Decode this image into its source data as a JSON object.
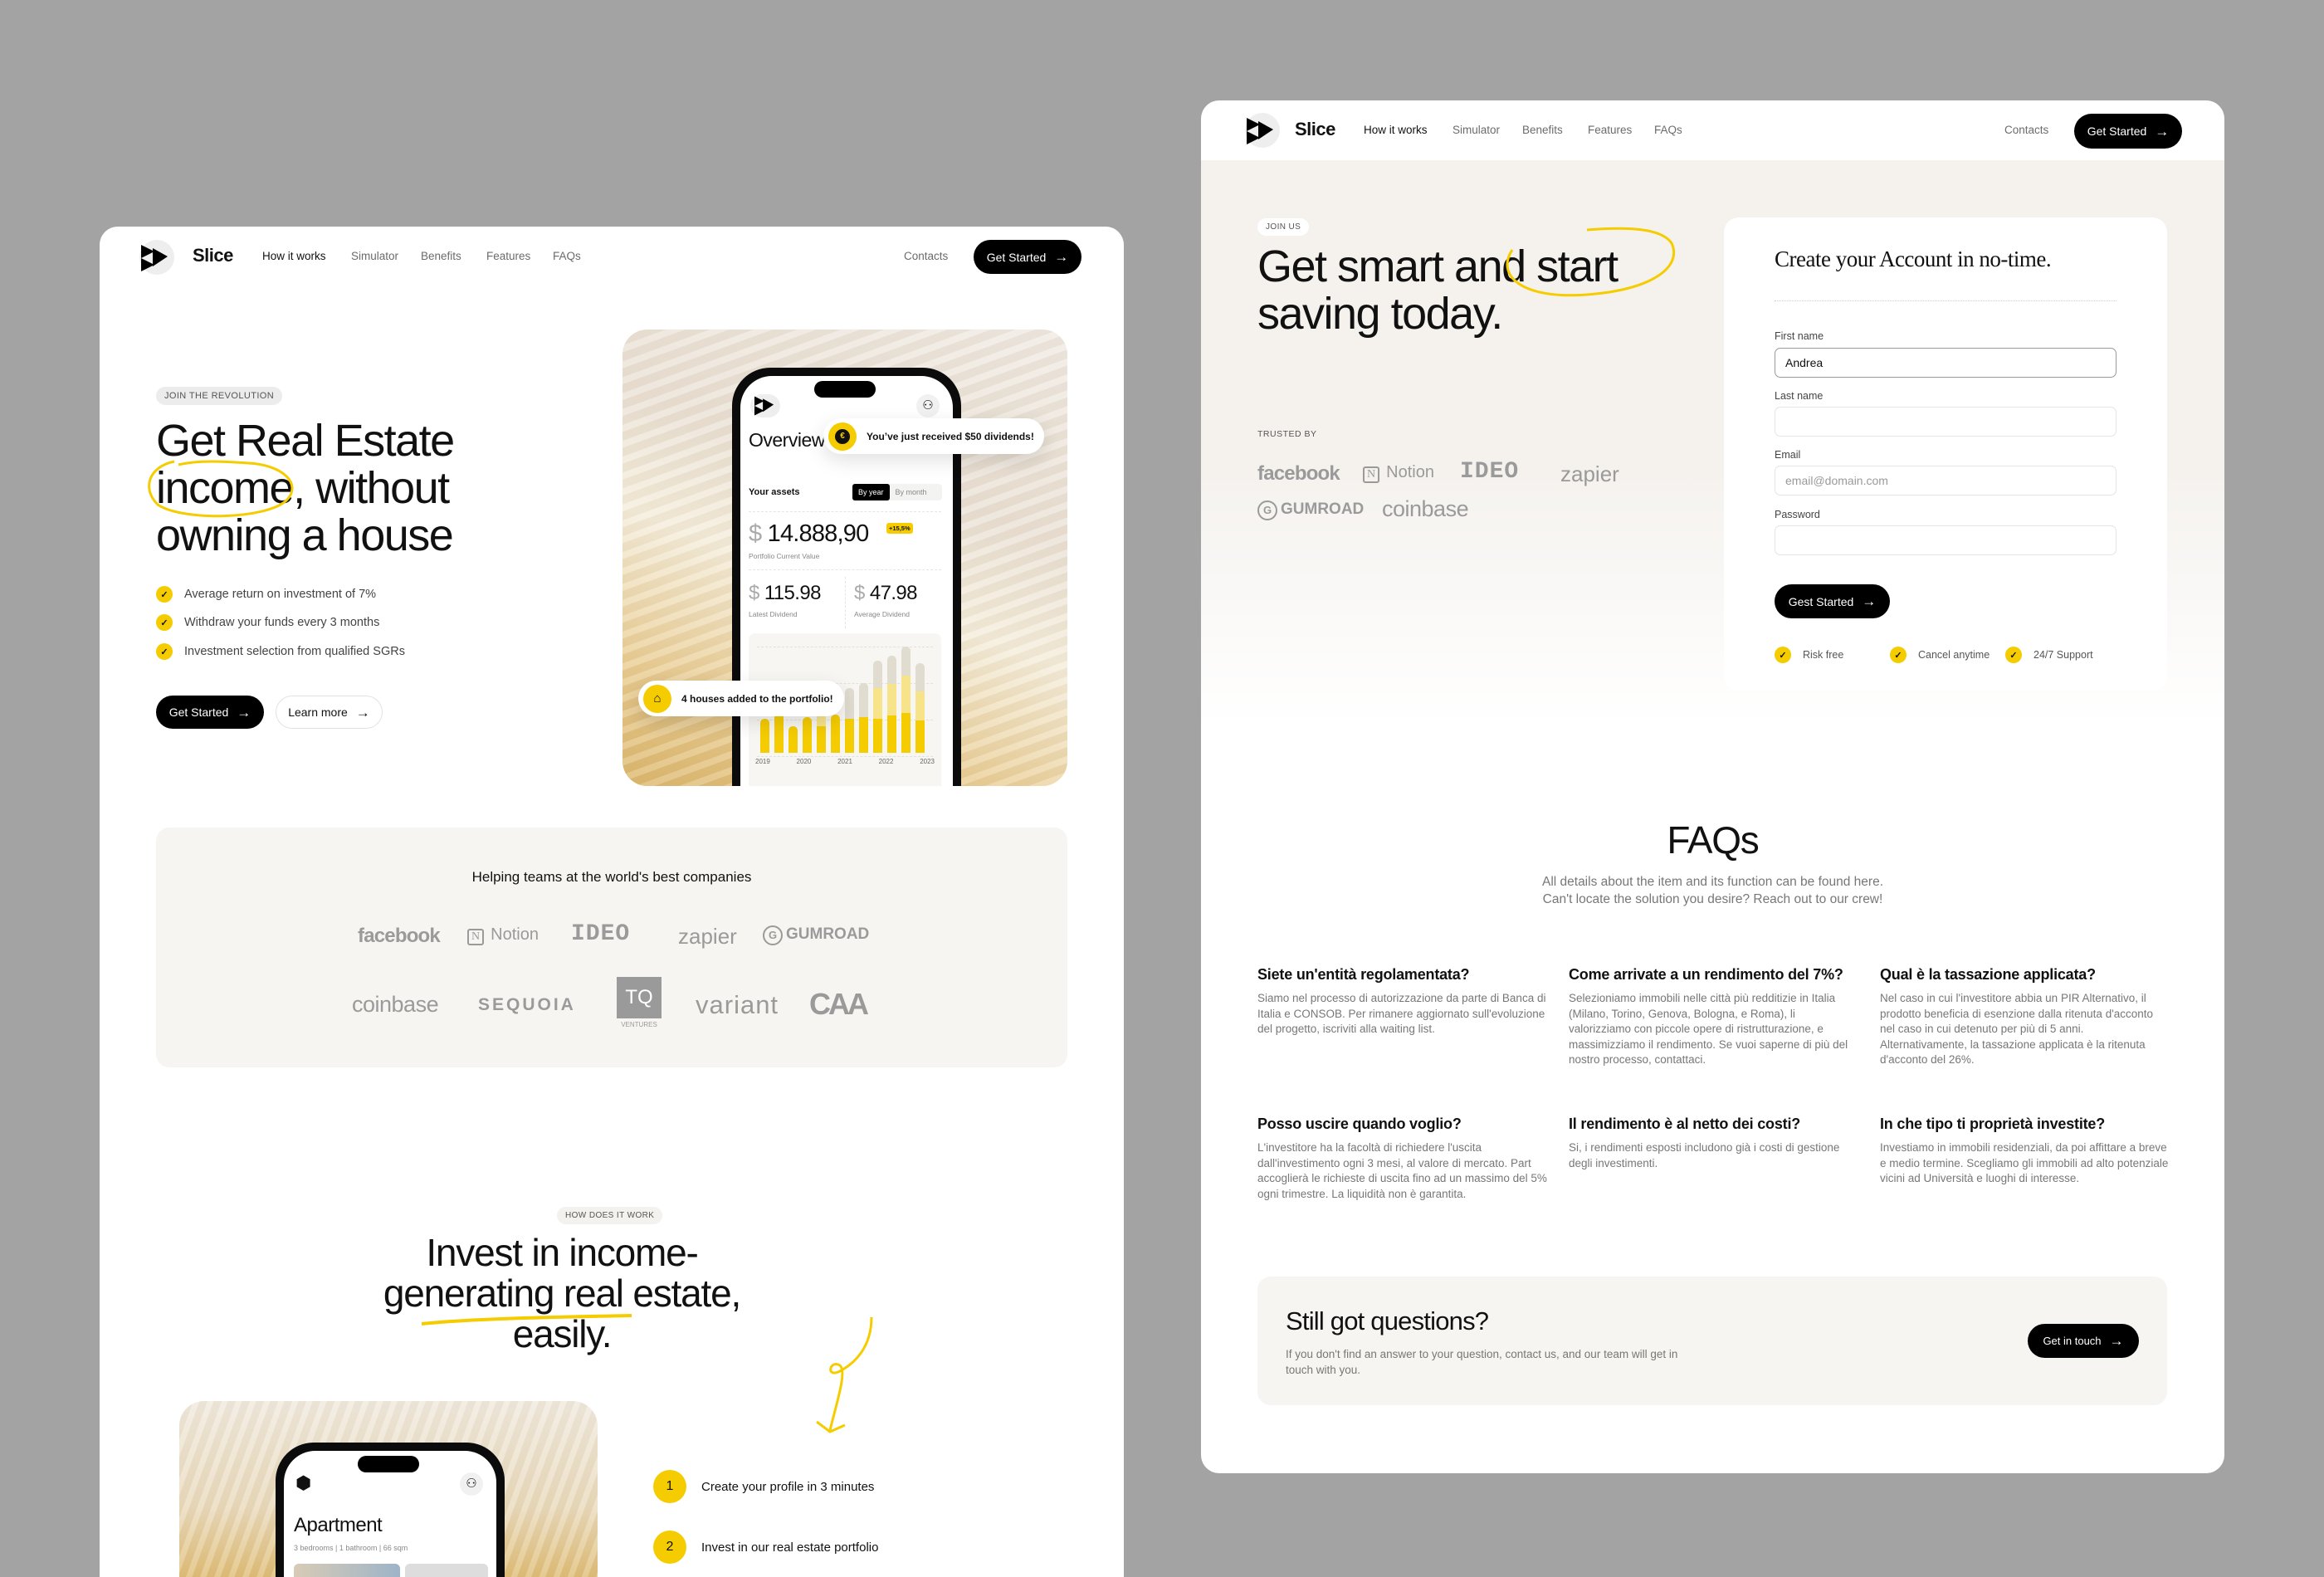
{
  "colors": {
    "background": "#a3a3a3",
    "accent": "#f5cc00",
    "dark": "#000000",
    "beige": "#f7f5f1"
  },
  "left_page": {
    "nav": {
      "brand": "Slice",
      "links": [
        "How it works",
        "Simulator",
        "Benefits",
        "Features",
        "FAQs"
      ],
      "contacts": "Contacts",
      "cta": "Get Started"
    },
    "hero": {
      "badge": "JOIN THE REVOLUTION",
      "line1": "Get Real Estate",
      "highlight": "income",
      "line2_rest": ", without",
      "line3": "owning a house",
      "features": [
        "Average return on investment of 7%",
        "Withdraw your funds every 3 months",
        "Investment selection from qualified SGRs"
      ],
      "primary_cta": "Get Started",
      "secondary_cta": "Learn more"
    },
    "phone": {
      "title": "Overview",
      "assets_label": "Your assets",
      "toggle": [
        "By year",
        "By month"
      ],
      "currency": "$",
      "portfolio_value": "14.888,90",
      "change_badge": "+15,5%",
      "portfolio_label": "Portfolio Current Value",
      "latest_dividend": "115.98",
      "latest_label": "Latest Dividend",
      "average_dividend": "47.98",
      "average_label": "Average Dividend",
      "years": [
        "2019",
        "2020",
        "2021",
        "2022",
        "2023"
      ],
      "bars": [
        [
          41,
          0,
          0
        ],
        [
          48,
          0,
          0
        ],
        [
          32,
          0,
          0
        ],
        [
          43,
          0,
          0
        ],
        [
          32,
          14,
          24
        ],
        [
          46,
          0,
          0
        ],
        [
          41,
          0,
          37
        ],
        [
          43,
          0,
          41
        ],
        [
          41,
          37,
          33
        ],
        [
          45,
          38,
          34
        ],
        [
          48,
          45,
          35
        ],
        [
          39,
          35,
          34
        ]
      ]
    },
    "notifications": {
      "dividend": "You’ve just received $50 dividends!",
      "houses": "4 houses added to the portfolio!"
    },
    "logos_section": {
      "title": "Helping teams at the world's best companies",
      "row1": [
        "facebook",
        "Notion",
        "IDEO",
        "zapier",
        "GUMROAD"
      ],
      "row2": [
        "coinbase",
        "SEQUOIA",
        "TQ",
        "variant",
        "CAA"
      ],
      "tq_sub": "VENTURES"
    },
    "how": {
      "badge": "HOW DOES IT WORK",
      "line1": "Invest in income-",
      "highlight": "generating",
      "line2_rest": " real estate,",
      "line3": "easily.",
      "steps": [
        {
          "num": "1",
          "text": "Create your profile in 3 minutes"
        },
        {
          "num": "2",
          "text": "Invest in our real estate portfolio"
        }
      ],
      "apartment": {
        "title": "Apartment",
        "details": [
          "3 bedrooms",
          "1 bathroom",
          "66 sqm"
        ]
      }
    }
  },
  "right_page": {
    "nav": {
      "brand": "Slice",
      "links": [
        "How it works",
        "Simulator",
        "Benefits",
        "Features",
        "FAQs"
      ],
      "contacts": "Contacts",
      "cta": "Get Started"
    },
    "hero": {
      "badge": "JOIN US",
      "line1": "Get smart and start",
      "line2": "saving today.",
      "trusted_label": "TRUSTED BY",
      "logos_row1": [
        "facebook",
        "Notion",
        "IDEO",
        "zapier"
      ],
      "logos_row2": [
        "GUMROAD",
        "coinbase"
      ]
    },
    "form": {
      "title": "Create your Account in no-time.",
      "fields": [
        {
          "label": "First name",
          "value": "Andrea",
          "placeholder": ""
        },
        {
          "label": "Last name",
          "value": "",
          "placeholder": ""
        },
        {
          "label": "Email",
          "value": "",
          "placeholder": "email@domain.com"
        },
        {
          "label": "Password",
          "value": "",
          "placeholder": ""
        }
      ],
      "submit": "Gest Started",
      "perks": [
        "Risk free",
        "Cancel anytime",
        "24/7 Support"
      ]
    },
    "faqs": {
      "title": "FAQs",
      "subtitle_1": "All details about the item and its function can be found here.",
      "subtitle_2": "Can't locate the solution you desire? Reach out to our crew!",
      "items": [
        {
          "q": "Siete un'entità regolamentata?",
          "a": "Siamo nel processo di autorizzazione da parte di Banca di Italia e CONSOB. Per rimanere aggiornato sull'evoluzione del progetto, iscriviti alla waiting list."
        },
        {
          "q": "Come arrivate a un rendimento del 7%?",
          "a": "Selezioniamo immobili nelle città più redditizie in Italia (Milano, Torino, Genova, Bologna, e Roma), li valorizziamo con piccole opere di ristrutturazione, e massimizziamo il rendimento. Se vuoi saperne di più del nostro processo, contattaci."
        },
        {
          "q": "Qual è la tassazione applicata?",
          "a": "Nel caso in cui l'investitore abbia un PIR Alternativo, il prodotto beneficia di esenzione dalla ritenuta d'acconto nel caso in cui detenuto per più di 5 anni. Alternativamente, la tassazione applicata è la ritenuta d'acconto del 26%."
        },
        {
          "q": "Posso uscire quando voglio?",
          "a": "L'investitore ha la facoltà di richiedere l'uscita dall'investimento ogni 3 mesi, al valore di mercato. Part accoglierà le richieste di uscita fino ad un massimo del 5% ogni trimestre. La liquidità non è garantita."
        },
        {
          "q": "Il rendimento è al netto dei costi?",
          "a": "Si, i rendimenti esposti includono già i costi di gestione degli investimenti."
        },
        {
          "q": "In che tipo ti proprietà investite?",
          "a": "Investiamo in immobili residenziali, da poi affittare a breve e medio termine. Scegliamo gli immobili ad alto potenziale vicini ad Università e luoghi di interesse."
        }
      ]
    },
    "contact": {
      "title": "Still got questions?",
      "text": "If you don't find an answer to your question, contact us, and our team will get in touch with you.",
      "cta": "Get in touch"
    }
  }
}
